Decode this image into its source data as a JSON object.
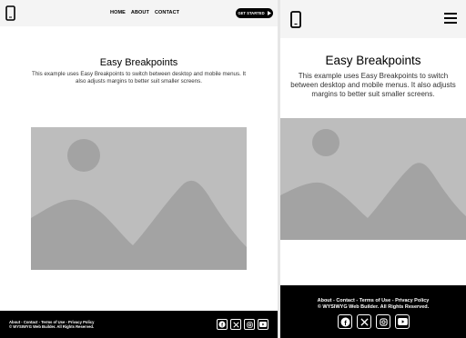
{
  "desktop": {
    "nav": {
      "home": "HOME",
      "about": "ABOUT",
      "contact": "CONTACT"
    },
    "cta_label": "GET STARTED",
    "title": "Easy Breakpoints",
    "description": "This example uses Easy Breakpoints to switch between desktop and mobile menus. It also adjusts margins to better suit smaller screens.",
    "footer_links": "About - Contact - Terms of Use - Privacy Policy",
    "footer_copyright": "© WYSIWYG Web Builder. All Rights Reserved."
  },
  "mobile": {
    "title": "Easy Breakpoints",
    "description": "This example uses Easy Breakpoints to switch between desktop and mobile menus. It also adjusts margins to better suit smaller screens.",
    "footer_links": "About - Contact - Terms of Use - Privacy Policy",
    "footer_copyright": "© WYSIWYG Web Builder. All Rights Reserved."
  },
  "icons": [
    "phone-icon",
    "arrow-icon",
    "hamburger-icon",
    "facebook-icon",
    "x-icon",
    "instagram-icon",
    "youtube-icon"
  ],
  "colors": {
    "header_bg": "#f4f4f4",
    "footer_bg": "#000000",
    "placeholder_bg": "#bdbdbd",
    "placeholder_shape": "#a3a3a3"
  }
}
